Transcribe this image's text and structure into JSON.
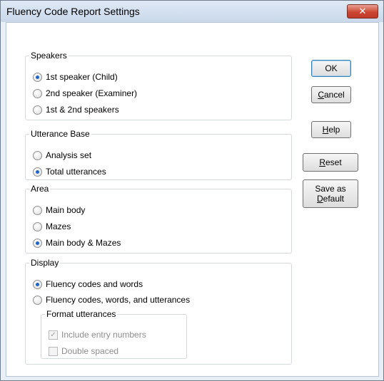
{
  "window": {
    "title": "Fluency Code Report Settings",
    "close_glyph": "✕"
  },
  "speakers": {
    "legend": "Speakers",
    "options": [
      {
        "label": "1st speaker (Child)",
        "checked": true
      },
      {
        "label": "2nd speaker (Examiner)",
        "checked": false
      },
      {
        "label": "1st & 2nd speakers",
        "checked": false
      }
    ]
  },
  "utterance_base": {
    "legend": "Utterance Base",
    "options": [
      {
        "label": "Analysis set",
        "checked": false
      },
      {
        "label": "Total utterances",
        "checked": true
      }
    ]
  },
  "area": {
    "legend": "Area",
    "options": [
      {
        "label": "Main body",
        "checked": false
      },
      {
        "label": "Mazes",
        "checked": false
      },
      {
        "label": "Main body & Mazes",
        "checked": true
      }
    ]
  },
  "display": {
    "legend": "Display",
    "options": [
      {
        "label": "Fluency codes and words",
        "checked": true
      },
      {
        "label": "Fluency codes, words, and utterances",
        "checked": false
      }
    ],
    "format": {
      "legend": "Format utterances",
      "options": [
        {
          "label": "Include entry numbers",
          "checked": true,
          "enabled": false
        },
        {
          "label": "Double spaced",
          "checked": false,
          "enabled": false
        }
      ]
    }
  },
  "buttons": {
    "ok": {
      "label": "OK"
    },
    "cancel": {
      "mnemonic": "C",
      "rest": "ancel"
    },
    "help": {
      "mnemonic": "H",
      "rest": "elp"
    },
    "reset": {
      "mnemonic": "R",
      "rest": "eset"
    },
    "save_default": {
      "line1": "Save as",
      "mnemonic": "D",
      "rest": "efault"
    }
  }
}
